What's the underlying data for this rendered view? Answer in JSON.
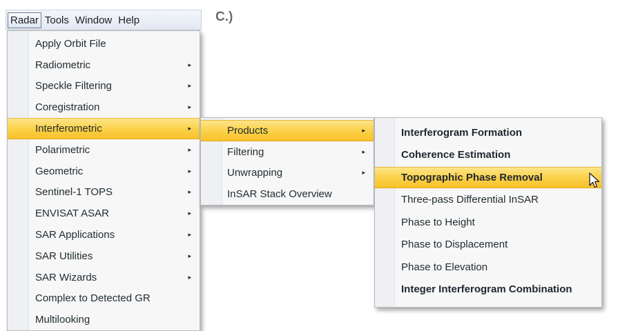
{
  "menubar": {
    "items": [
      "Radar",
      "Tools",
      "Window",
      "Help"
    ]
  },
  "figure_label": "C.)",
  "radar_menu": {
    "items": [
      {
        "label": "Apply Orbit File",
        "arrow": false
      },
      {
        "label": "Radiometric",
        "arrow": true
      },
      {
        "label": "Speckle Filtering",
        "arrow": true
      },
      {
        "label": "Coregistration",
        "arrow": true
      },
      {
        "label": "Interferometric",
        "arrow": true,
        "highlighted": true
      },
      {
        "label": "Polarimetric",
        "arrow": true
      },
      {
        "label": "Geometric",
        "arrow": true
      },
      {
        "label": "Sentinel-1 TOPS",
        "arrow": true
      },
      {
        "label": "ENVISAT ASAR",
        "arrow": true
      },
      {
        "label": "SAR Applications",
        "arrow": true
      },
      {
        "label": "SAR Utilities",
        "arrow": true
      },
      {
        "label": "SAR Wizards",
        "arrow": true
      },
      {
        "label": "Complex to Detected GR",
        "arrow": false
      },
      {
        "label": "Multilooking",
        "arrow": false
      }
    ]
  },
  "interferometric_menu": {
    "items": [
      {
        "label": "Products",
        "arrow": true,
        "highlighted": true
      },
      {
        "label": "Filtering",
        "arrow": true
      },
      {
        "label": "Unwrapping",
        "arrow": true
      },
      {
        "label": "InSAR Stack Overview",
        "arrow": false
      }
    ]
  },
  "products_menu": {
    "items": [
      {
        "label": "Interferogram Formation",
        "bold": true
      },
      {
        "label": "Coherence Estimation",
        "bold": true
      },
      {
        "label": "Topographic Phase Removal",
        "bold": true,
        "highlighted": true
      },
      {
        "label": "Three-pass Differential InSAR"
      },
      {
        "label": "Phase to Height"
      },
      {
        "label": "Phase to Displacement"
      },
      {
        "label": "Phase to Elevation"
      },
      {
        "label": "Integer Interferogram Combination",
        "bold": true
      }
    ]
  },
  "icons": {
    "submenu_arrow": "submenu-arrow-icon",
    "cursor": "mouse-pointer-icon"
  },
  "colors": {
    "highlight": "#fbd24a",
    "menu_bg": "#f7f7f7"
  }
}
